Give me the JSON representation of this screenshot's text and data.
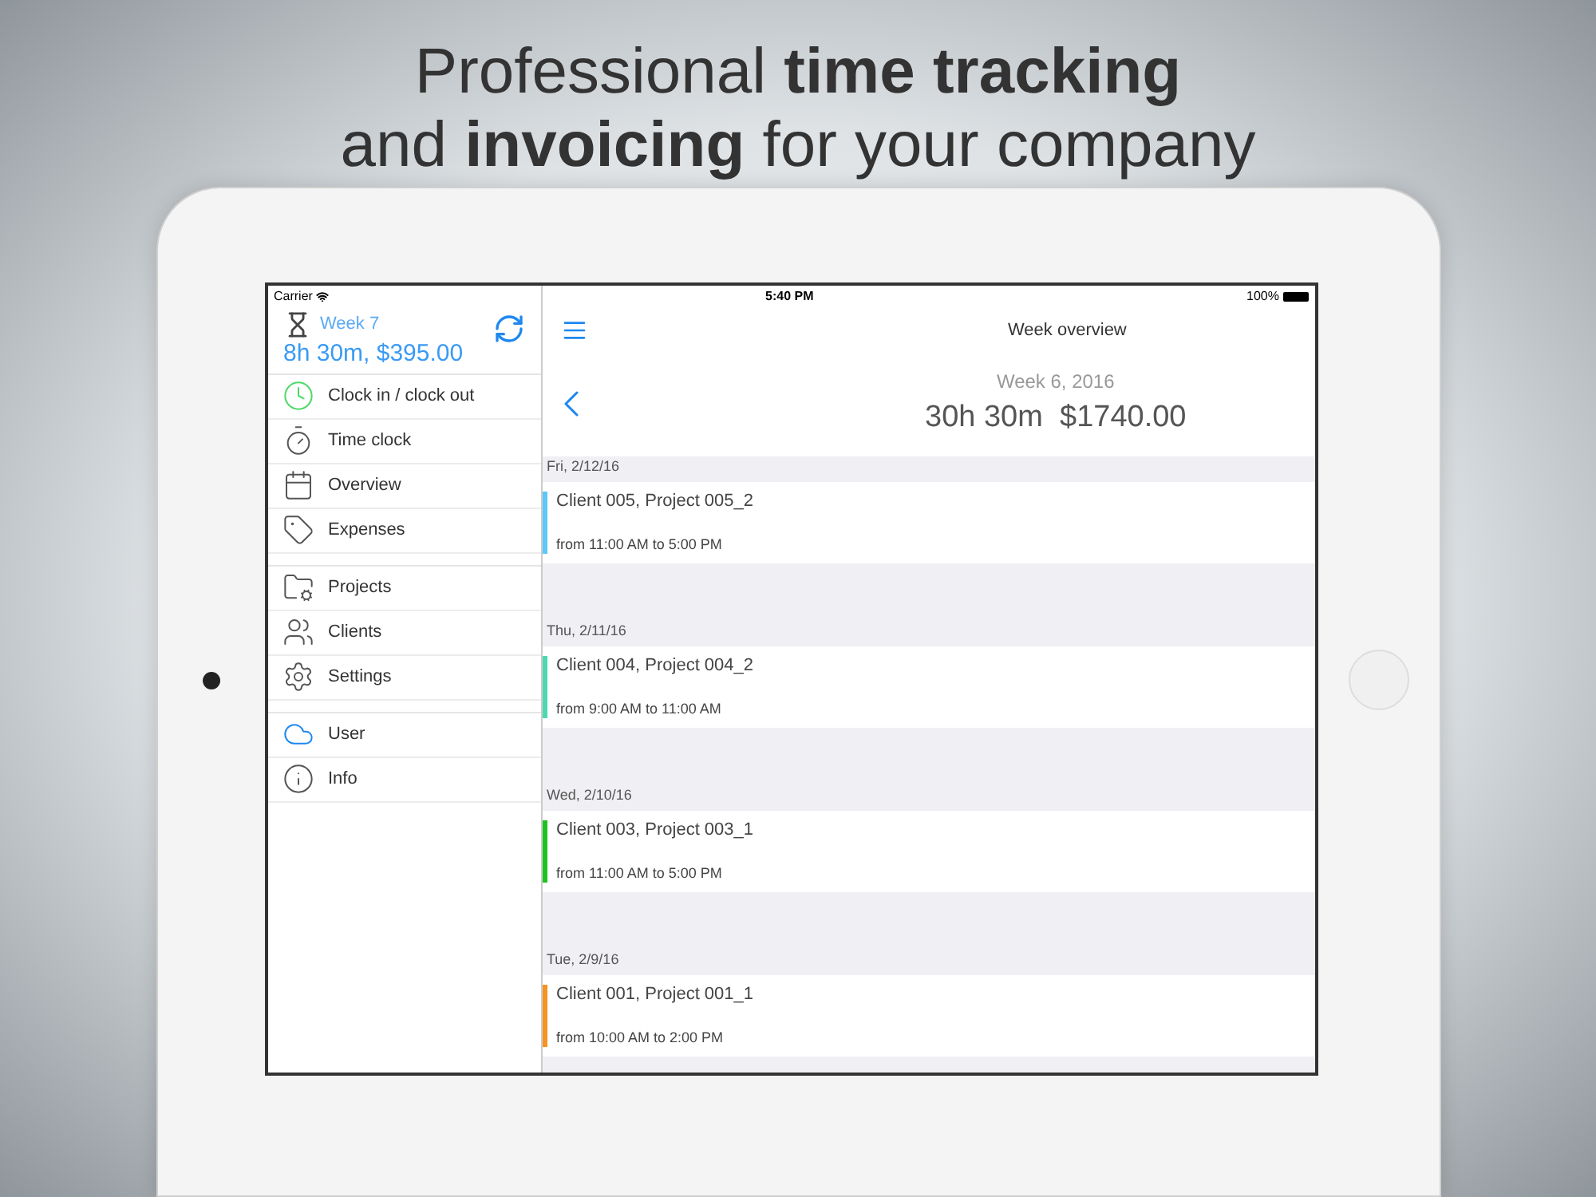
{
  "headline": [
    "Professional **time tracking**",
    "and **invoicing** for your company"
  ],
  "status_bar": {
    "carrier": "Carrier",
    "time": "5:40 PM",
    "battery": "100%"
  },
  "sidebar": {
    "week": "Week 7",
    "total": "8h 30m, $395.00",
    "groups": [
      [
        {
          "label": "Clock in / clock out"
        },
        {
          "label": "Time clock"
        },
        {
          "label": "Overview"
        },
        {
          "label": "Expenses"
        }
      ],
      [
        {
          "label": "Projects"
        },
        {
          "label": "Clients"
        },
        {
          "label": "Settings"
        }
      ],
      [
        {
          "label": "User"
        },
        {
          "label": "Info"
        }
      ]
    ]
  },
  "main": {
    "title": "Week overview",
    "week": "Week 6, 2016",
    "summary": "30h 30m  $1740.00",
    "days": [
      {
        "date": "Fri, 2/12/16",
        "entries": [
          {
            "title": "Client 005, Project 005_2",
            "time": "from 11:00 AM to 5:00 PM",
            "color": "#5ac8fa"
          }
        ]
      },
      {
        "date": "Thu, 2/11/16",
        "entries": [
          {
            "title": "Client 004, Project 004_2",
            "time": "from 9:00 AM to 11:00 AM",
            "color": "#4cd9b0"
          }
        ]
      },
      {
        "date": "Wed, 2/10/16",
        "entries": [
          {
            "title": "Client 003, Project 003_1",
            "time": "from 11:00 AM to 5:00 PM",
            "color": "#1dc21d"
          }
        ]
      },
      {
        "date": "Tue, 2/9/16",
        "entries": [
          {
            "title": "Client 001, Project 001_1",
            "time": "from 10:00 AM to 2:00 PM",
            "color": "#f7931e"
          }
        ]
      }
    ]
  }
}
